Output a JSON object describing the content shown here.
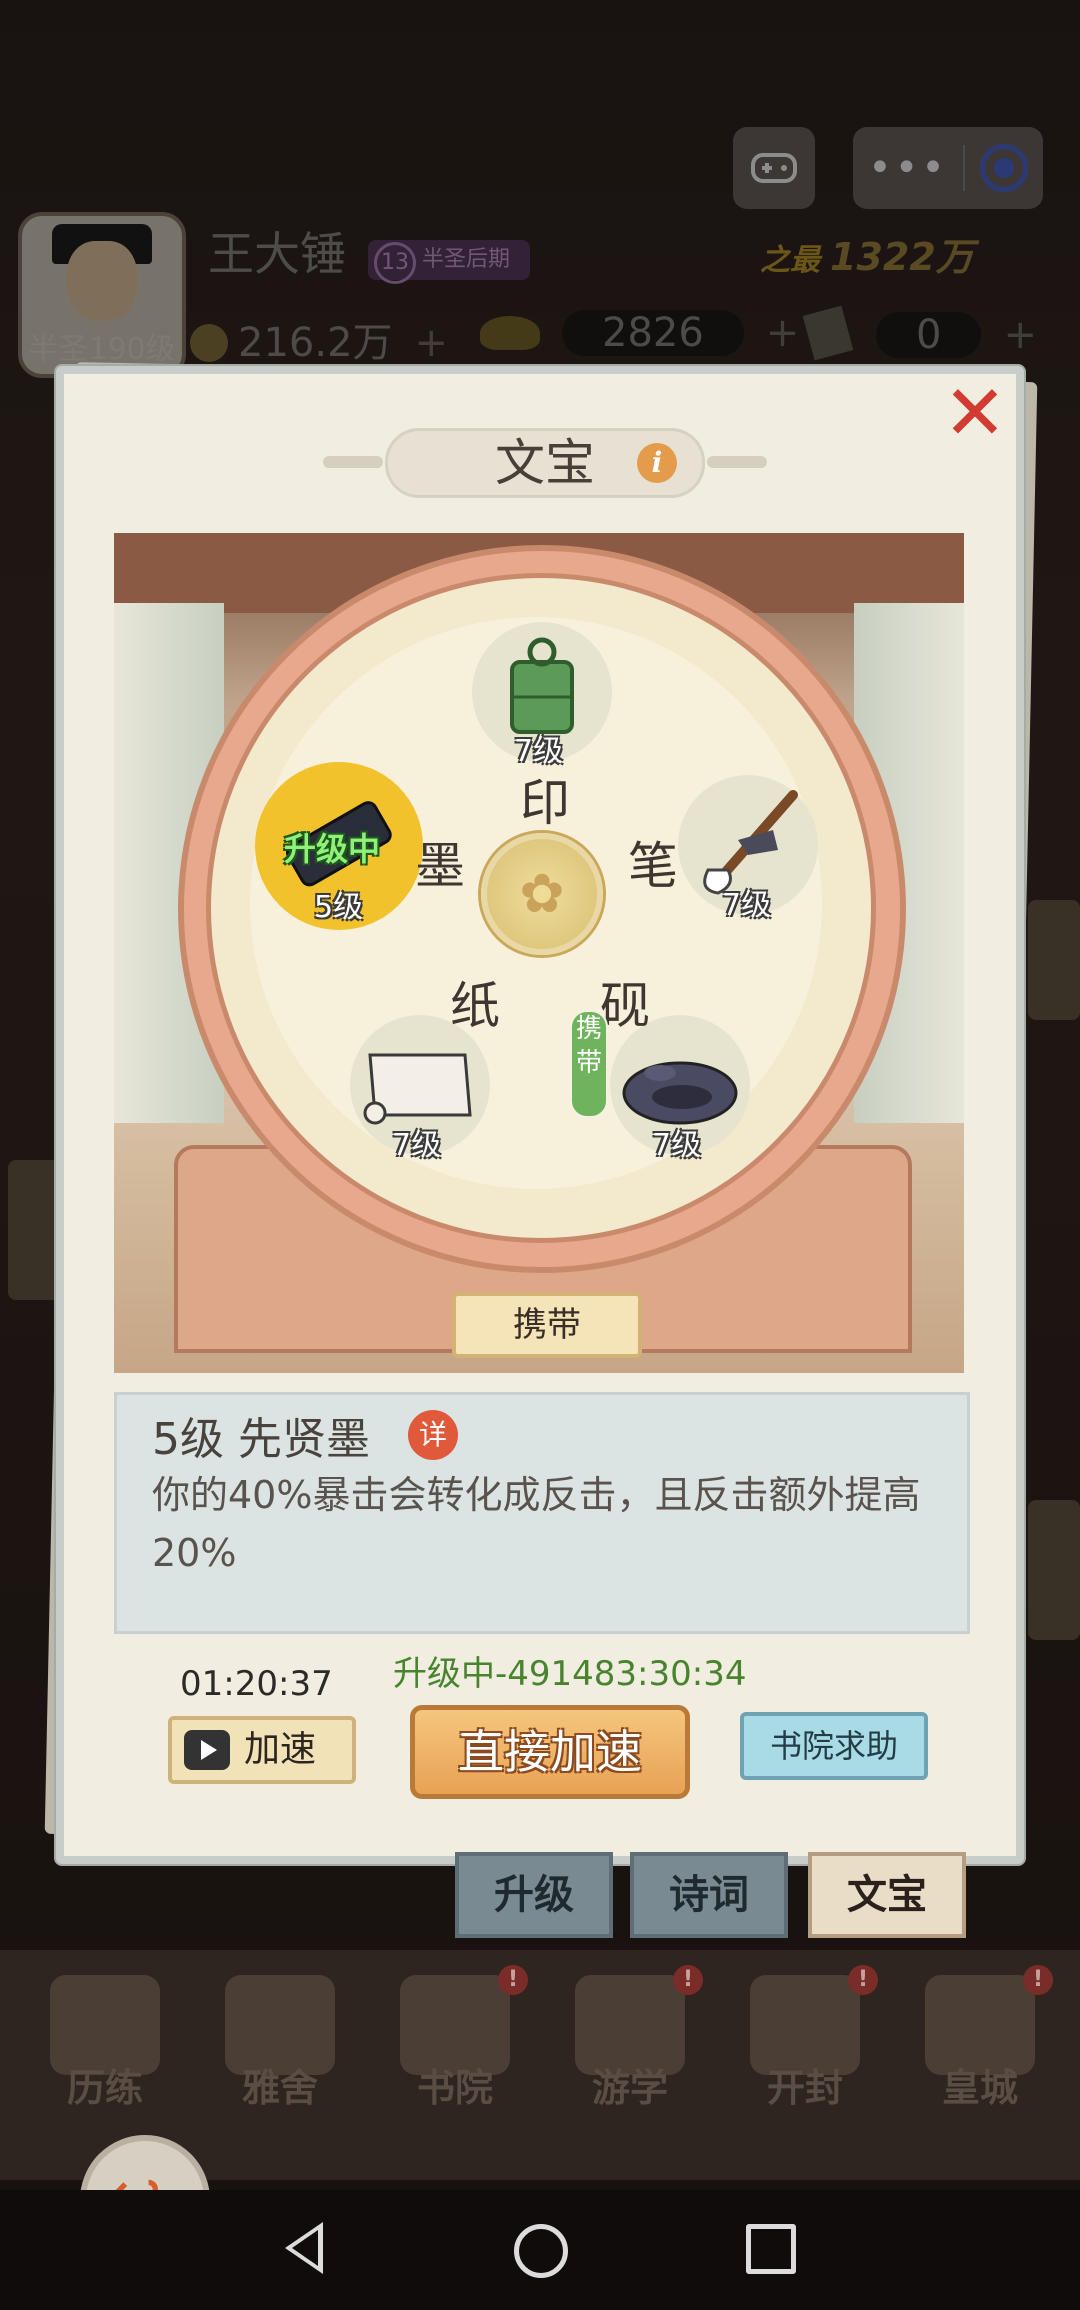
{
  "top_bar": {
    "gamepad_icon": "gamepad-icon",
    "menu_dots": "•••",
    "target_icon": "target-icon"
  },
  "player": {
    "name": "王大锤",
    "level_label": "半圣190级",
    "rank_number": "13",
    "rank_text": "半圣后期",
    "power_glyph": "之最",
    "power_value": "1322万"
  },
  "resources": {
    "coins": "216.2万",
    "ingots": "2826",
    "tickets": "0",
    "plus": "+"
  },
  "panel": {
    "title": "文宝",
    "info_icon": "i",
    "close_icon": "✕"
  },
  "treasures": {
    "seal": {
      "name": "印",
      "level": "7级"
    },
    "brush": {
      "name": "笔",
      "level": "7级"
    },
    "ink": {
      "name": "墨",
      "level": "5级",
      "status": "升级中"
    },
    "paper": {
      "name": "纸",
      "level": "7级"
    },
    "inkstone": {
      "name": "砚",
      "level": "7级",
      "carry_badge": "携带"
    },
    "center_symbol": "✿"
  },
  "carry_button": "携带",
  "description": {
    "title": "5级 先贤墨",
    "detail_button": "详",
    "text": "你的40%暴击会转化成反击，且反击额外提高20%"
  },
  "actions": {
    "timer": "01:20:37",
    "upgrade_status": "升级中-491483:30:34",
    "speed_up": "加速",
    "direct_speed_up": "直接加速",
    "academy_help": "书院求助"
  },
  "tabs": [
    {
      "label": "升级",
      "active": false
    },
    {
      "label": "诗词",
      "active": false
    },
    {
      "label": "文宝",
      "active": true
    }
  ],
  "bottom_nav": [
    {
      "label": "历练",
      "badge": ""
    },
    {
      "label": "雅舍",
      "badge": ""
    },
    {
      "label": "书院",
      "badge": "!"
    },
    {
      "label": "游学",
      "badge": "!"
    },
    {
      "label": "开封",
      "badge": "!"
    },
    {
      "label": "皇城",
      "badge": "!"
    }
  ],
  "back_button_icon": "↩",
  "colors": {
    "selected_slot": "#f2c22c",
    "upgrading_text": "#47842d",
    "close_red": "#d13b31",
    "direct_button": "#e8a253",
    "help_button": "#a9dbe6"
  }
}
